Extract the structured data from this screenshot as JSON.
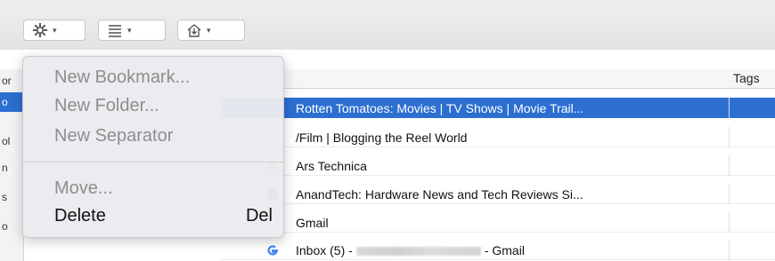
{
  "toolbar": {
    "organize_icon": "gear-icon",
    "views_icon": "list-icon",
    "import_icon": "import-backup-icon",
    "chevron": "▾"
  },
  "columns": {
    "tags_header": "Tags"
  },
  "bookmarks": [
    {
      "title": "Rotten Tomatoes: Movies | TV Shows | Movie Trail...",
      "selected": true
    },
    {
      "title": "/Film | Blogging the Reel World",
      "selected": false
    },
    {
      "title": "Ars Technica",
      "selected": false
    },
    {
      "title": "AnandTech: Hardware News and Tech Reviews Si...",
      "selected": false
    },
    {
      "title": "Gmail",
      "selected": false
    },
    {
      "title_prefix": "Inbox (5) -",
      "title_suffix": "- Gmail",
      "selected": false
    }
  ],
  "sidebar_fragments": [
    "or",
    "o",
    "ol",
    "n",
    "s",
    "o"
  ],
  "menu": {
    "new_bookmark": "New Bookmark...",
    "new_folder": "New Folder...",
    "new_separator": "New Separator",
    "move": "Move...",
    "delete": "Delete",
    "delete_shortcut": "Del"
  },
  "colors": {
    "selection": "#2c6fd1",
    "disabled_text": "#8e8e8e"
  }
}
